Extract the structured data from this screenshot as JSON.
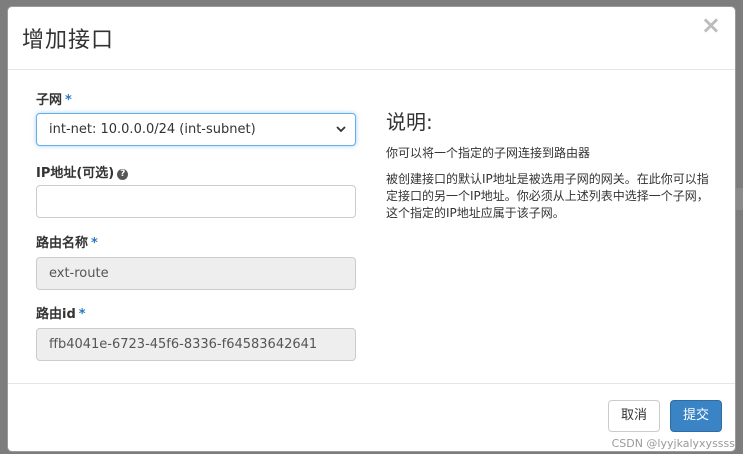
{
  "dialog": {
    "title": "增加接口",
    "close_label": "×"
  },
  "form": {
    "subnet": {
      "label": "子网",
      "required_mark": "*",
      "value": "int-net: 10.0.0.0/24 (int-subnet)"
    },
    "ip_address": {
      "label": "IP地址(可选)",
      "help_icon": "question-circle-icon",
      "value": ""
    },
    "router_name": {
      "label": "路由名称",
      "required_mark": "*",
      "value": "ext-route"
    },
    "router_id": {
      "label": "路由id",
      "required_mark": "*",
      "value": "ffb4041e-6723-45f6-8336-f64583642641"
    }
  },
  "description": {
    "title": "说明:",
    "paragraph1": "你可以将一个指定的子网连接到路由器",
    "paragraph2": "被创建接口的默认IP地址是被选用子网的网关。在此你可以指定接口的另一个IP地址。你必须从上述列表中选择一个子网，这个指定的IP地址应属于该子网。"
  },
  "footer": {
    "cancel_label": "取消",
    "submit_label": "提交"
  },
  "watermark": "CSDN @lyyjkalyxyssss",
  "colors": {
    "primary": "#3a84c6",
    "required": "#2a78c2",
    "focus_border": "#66afe9",
    "readonly_bg": "#eeeeee"
  }
}
